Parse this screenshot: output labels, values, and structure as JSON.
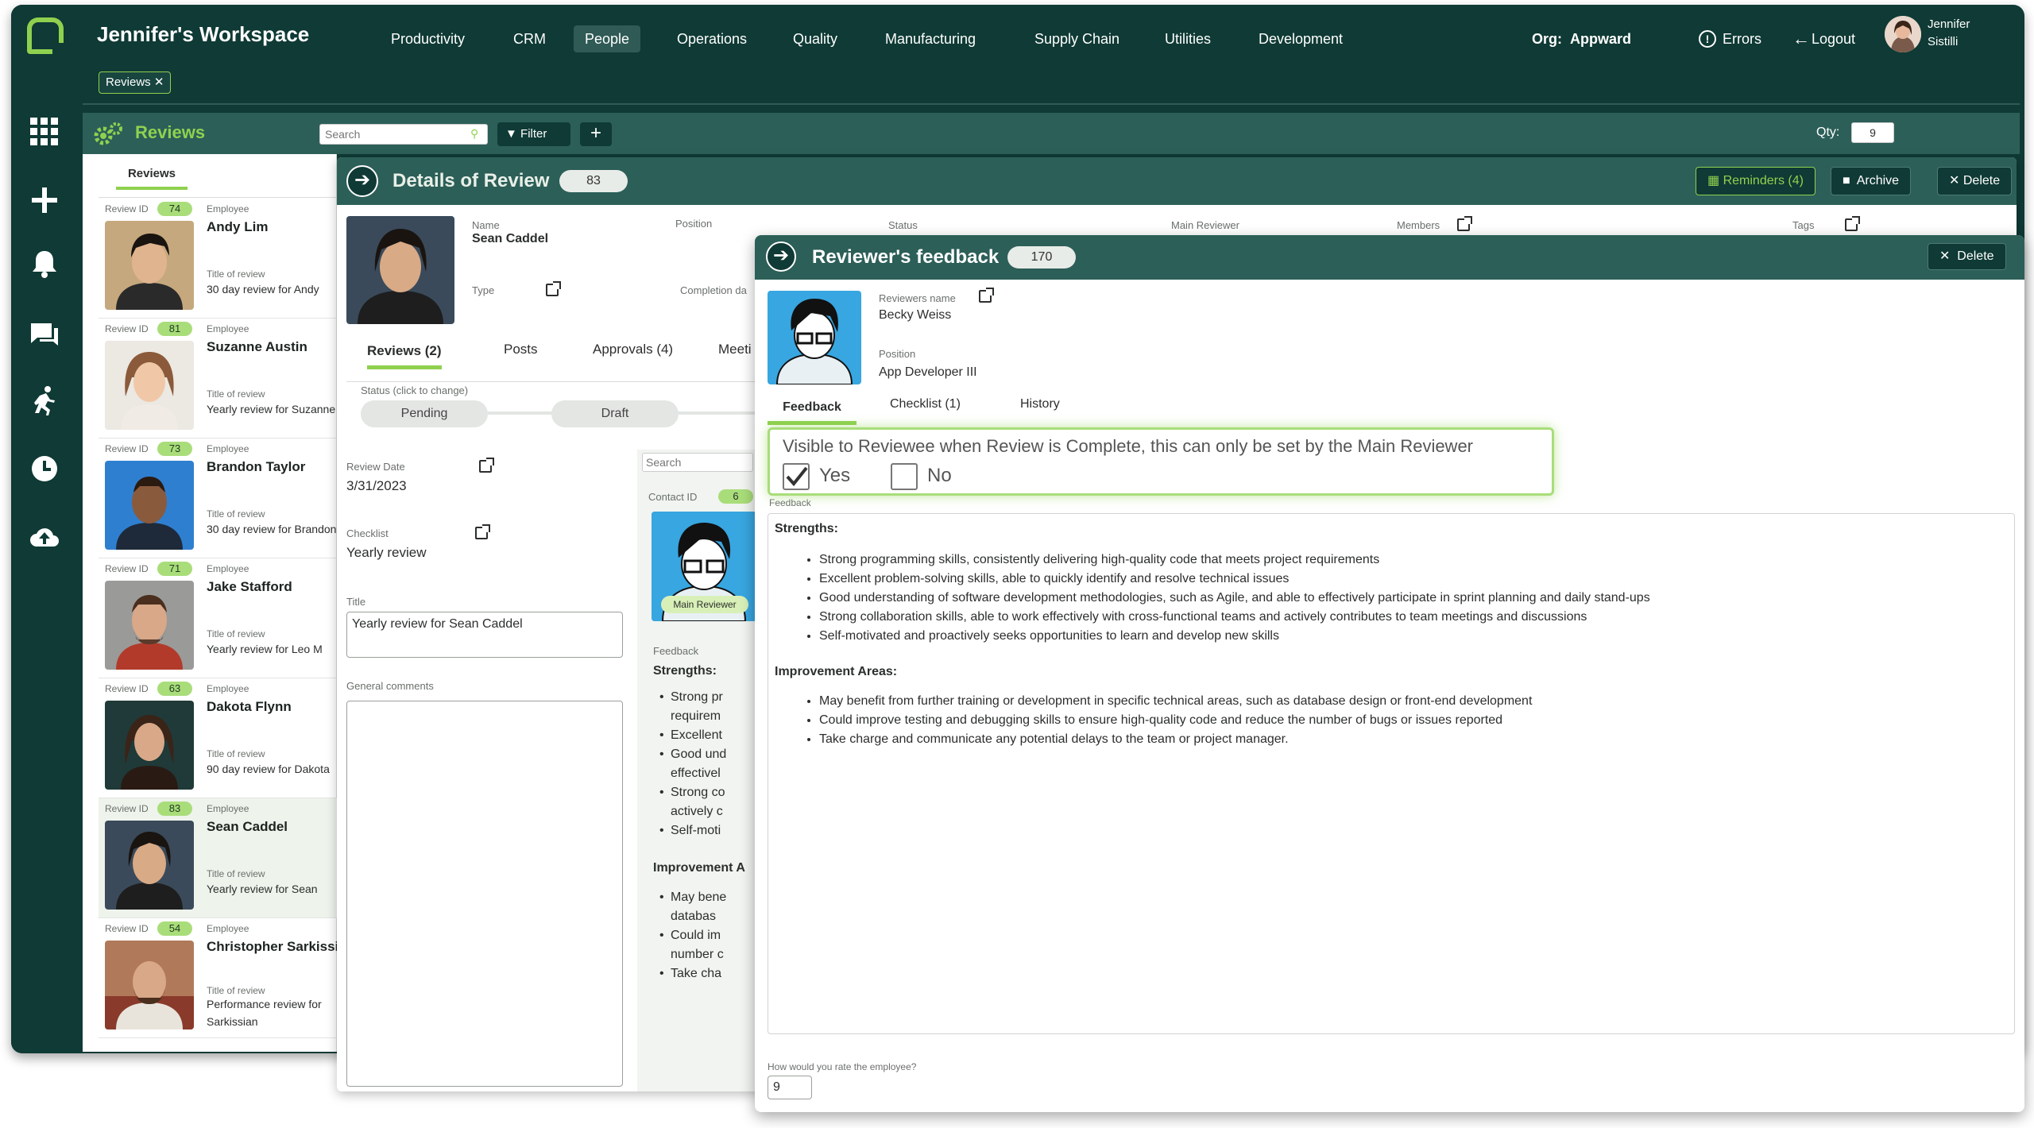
{
  "app": {
    "workspace_title": "Jennifer's Workspace",
    "org_label": "Org:",
    "org_name": "Appward",
    "errors_label": "Errors",
    "logout_label": "Logout",
    "user_first": "Jennifer",
    "user_last": "Sistilli"
  },
  "nav": {
    "items": [
      "Productivity",
      "CRM",
      "People",
      "Operations",
      "Quality",
      "Manufacturing",
      "Supply Chain",
      "Utilities",
      "Development"
    ],
    "active": "People"
  },
  "tagbar": {
    "chip_label": "Reviews"
  },
  "listbar": {
    "title": "Reviews",
    "search_placeholder": "Search",
    "filter_label": "Filter",
    "qty_label": "Qty:",
    "qty_value": "9"
  },
  "list": {
    "tab_label": "Reviews",
    "review_id_label": "Review ID",
    "employee_label": "Employee",
    "title_label": "Title of review",
    "cards": [
      {
        "id": "74",
        "name": "Andy Lim",
        "title": "30 day review for Andy"
      },
      {
        "id": "81",
        "name": "Suzanne Austin",
        "title": "Yearly review for Suzanne"
      },
      {
        "id": "73",
        "name": "Brandon Taylor",
        "title": "30 day review for Brandon"
      },
      {
        "id": "71",
        "name": "Jake Stafford",
        "title": "Yearly review for Leo M"
      },
      {
        "id": "63",
        "name": "Dakota Flynn",
        "title": "90 day review for Dakota"
      },
      {
        "id": "83",
        "name": "Sean Caddel",
        "title": "Yearly review for Sean"
      },
      {
        "id": "54",
        "name": "Christopher Sarkissian",
        "title": "Performance review for",
        "title2": "Sarkissian"
      }
    ]
  },
  "details": {
    "title": "Details of Review",
    "badge": "83",
    "reminders_label": "Reminders (4)",
    "archive_label": "Archive",
    "delete_label": "Delete",
    "name_label": "Name",
    "name_value": "Sean Caddel",
    "position_label": "Position",
    "status_label": "Status",
    "main_reviewer_label": "Main Reviewer",
    "members_label": "Members",
    "tags_label": "Tags",
    "type_label": "Type",
    "completion_label": "Completion da",
    "tabs": [
      "Reviews (2)",
      "Posts",
      "Approvals (4)",
      "Meeti"
    ],
    "status_hint": "Status (click to change)",
    "status_steps": [
      "Pending",
      "Draft"
    ],
    "review_date_label": "Review Date",
    "review_date_value": "3/31/2023",
    "checklist_label": "Checklist",
    "checklist_value": "Yearly review",
    "title_field_label": "Title",
    "title_field_value": "Yearly review for Sean Caddel",
    "comments_label": "General comments",
    "search_placeholder": "Search",
    "contact_id_label": "Contact ID",
    "contact_id_value": "6",
    "main_reviewer_tag": "Main Reviewer",
    "feedback_label": "Feedback",
    "strengths_label": "Strengths:",
    "strengths_lines": [
      "Strong pr",
      "requirem",
      "Excellent",
      "Good und",
      "effectivel",
      "Strong co",
      "actively c",
      "Self-moti"
    ],
    "improvement_label": "Improvement A",
    "improvement_lines": [
      "May bene",
      "databas",
      "Could im",
      "number c",
      "Take cha"
    ]
  },
  "feedback": {
    "title": "Reviewer's feedback",
    "badge": "170",
    "delete_label": "Delete",
    "reviewer_name_label": "Reviewers name",
    "reviewer_name_value": "Becky Weiss",
    "position_label": "Position",
    "position_value": "App Developer III",
    "tabs": [
      "Feedback",
      "Checklist (1)",
      "History"
    ],
    "visible_text": "Visible to Reviewee when Review is Complete, this can only be set by the Main Reviewer",
    "yes_label": "Yes",
    "no_label": "No",
    "yes_checked": true,
    "feedback_field_label": "Feedback",
    "strengths_heading": "Strengths:",
    "strengths": [
      "Strong programming skills, consistently delivering high-quality code that meets project requirements",
      "Excellent problem-solving skills, able to quickly identify and resolve technical issues",
      "Good understanding of software development methodologies, such as Agile, and able to effectively participate in sprint planning and daily stand-ups",
      "Strong collaboration skills, able to work effectively with cross-functional teams and actively contributes to team meetings and discussions",
      "Self-motivated and proactively seeks opportunities to learn and develop new skills"
    ],
    "improvement_heading": "Improvement Areas:",
    "improvements": [
      "May benefit from further training or development in specific technical areas, such as database design or front-end development",
      "Could improve testing and debugging skills to ensure high-quality code and reduce the number of bugs or issues reported",
      "Take charge and communicate any potential delays to the team or project manager."
    ],
    "rating_label": "How would you rate the employee?",
    "rating_value": "9"
  },
  "colors": {
    "primary": "#0f3a35",
    "header": "#2c5f58",
    "accent": "#8fd14f",
    "badge": "#a9dd7a"
  },
  "icons": [
    "logo-icon",
    "apps-grid-icon",
    "plus-icon",
    "bell-icon",
    "chat-icon",
    "runner-icon",
    "clock-icon",
    "cloud-upload-icon",
    "gears-icon",
    "filter-icon",
    "arrow-right-icon",
    "calendar-icon",
    "archive-icon",
    "close-icon",
    "external-link-icon",
    "alert-icon",
    "arrow-left-icon",
    "check-icon"
  ]
}
